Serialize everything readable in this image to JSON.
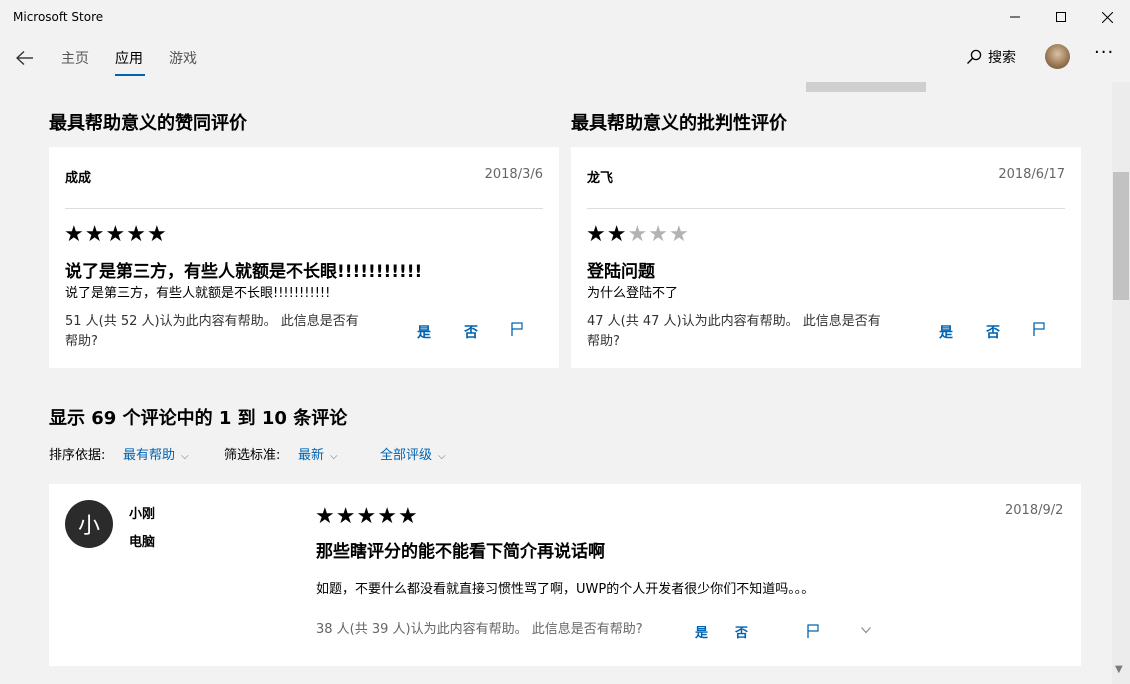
{
  "window": {
    "title": "Microsoft Store"
  },
  "nav": {
    "tabs": [
      "主页",
      "应用",
      "游戏"
    ],
    "active_tab": "应用",
    "search_label": "搜索",
    "more_label": "···"
  },
  "positive": {
    "section_title": "最具帮助意义的赞同评价",
    "name": "成成",
    "date": "2018/3/6",
    "rating": 5,
    "title": "说了是第三方，有些人就额是不长眼!!!!!!!!!!!",
    "body": "说了是第三方，有些人就额是不长眼!!!!!!!!!!!",
    "helpful_line1": "51 人(共 52 人)认为此内容有帮助。 此信息是否有",
    "helpful_line2": "帮助?",
    "yes": "是",
    "no": "否"
  },
  "critical": {
    "section_title": "最具帮助意义的批判性评价",
    "name": "龙飞",
    "date": "2018/6/17",
    "rating": 2,
    "title": "登陆问题",
    "body": "为什么登陆不了",
    "helpful_line1": "47 人(共 47 人)认为此内容有帮助。 此信息是否有",
    "helpful_line2": "帮助?",
    "yes": "是",
    "no": "否"
  },
  "reviews_header": {
    "title": "显示 69 个评论中的 1 到 10 条评论",
    "sort_label": "排序依据:",
    "sort_value": "最有帮助",
    "filter_label": "筛选标准:",
    "filter_value": "最新",
    "rating_filter": "全部评级"
  },
  "review": {
    "avatar_letter": "小",
    "name": "小刚",
    "device": "电脑",
    "date": "2018/9/2",
    "rating": 5,
    "title": "那些瞎评分的能不能看下简介再说话啊",
    "body": "如题，不要什么都没看就直接习惯性骂了啊，UWP的个人开发者很少你们不知道吗。。。",
    "helpful": "38 人(共 39 人)认为此内容有帮助。 此信息是否有帮助?",
    "yes": "是",
    "no": "否"
  },
  "colors": {
    "accent": "#0063b1",
    "background": "#f2f2f2",
    "card": "#ffffff"
  }
}
